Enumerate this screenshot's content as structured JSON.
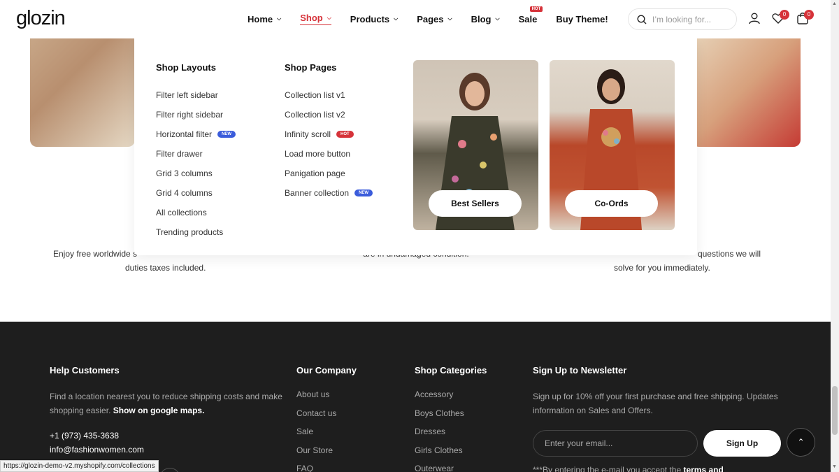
{
  "header": {
    "logo": "glozin",
    "nav": [
      {
        "label": "Home",
        "chevron": true
      },
      {
        "label": "Shop",
        "chevron": true,
        "active": true
      },
      {
        "label": "Products",
        "chevron": true
      },
      {
        "label": "Pages",
        "chevron": true
      },
      {
        "label": "Blog",
        "chevron": true
      },
      {
        "label": "Sale",
        "badge": "HOT"
      },
      {
        "label": "Buy Theme!"
      }
    ],
    "search_placeholder": "I’m looking for...",
    "wishlist_count": "0",
    "cart_count": "0"
  },
  "mega_menu": {
    "col1": {
      "title": "Shop Layouts",
      "items": [
        {
          "label": "Filter left sidebar"
        },
        {
          "label": "Filter right sidebar"
        },
        {
          "label": "Horizontal filter",
          "badge": "NEW"
        },
        {
          "label": "Filter drawer"
        },
        {
          "label": "Grid 3 columns"
        },
        {
          "label": "Grid 4 columns"
        },
        {
          "label": "All collections"
        },
        {
          "label": "Trending products"
        }
      ]
    },
    "col2": {
      "title": "Shop Pages",
      "items": [
        {
          "label": "Collection list v1"
        },
        {
          "label": "Collection list v2"
        },
        {
          "label": "Infinity scroll",
          "badge": "HOT"
        },
        {
          "label": "Load more button"
        },
        {
          "label": "Panigation page"
        },
        {
          "label": "Banner collection",
          "badge": "NEW"
        }
      ]
    },
    "promos": [
      {
        "button": "Best Sellers"
      },
      {
        "button": "Co-Ords"
      }
    ]
  },
  "features": {
    "left": [
      "Enjoy free worldwide s",
      "duties taxes included."
    ],
    "middle": [
      "are in undamaged condition."
    ],
    "right": [
      "questions we will",
      "solve for you immediately."
    ]
  },
  "footer": {
    "help": {
      "title": "Help Customers",
      "text": "Find a location nearest you to reduce shipping costs and make shopping easier.",
      "map_link": "Show on google maps.",
      "phone": "+1 (973) 435-3638",
      "email": "info@fashionwomen.com"
    },
    "company": {
      "title": "Our Company",
      "links": [
        "About us",
        "Contact us",
        "Sale",
        "Our Store",
        "FAQ"
      ]
    },
    "categories": {
      "title": "Shop Categories",
      "links": [
        "Accessory",
        "Boys Clothes",
        "Dresses",
        "Girls Clothes",
        "Outerwear"
      ]
    },
    "newsletter": {
      "title": "Sign Up to Newsletter",
      "text": "Sign up for 10% off your first purchase and free shipping. Updates information on Sales and Offers.",
      "email_placeholder": "Enter your email...",
      "button": "Sign Up",
      "terms_prefix": "***By entering the e-mail you accept the",
      "terms_link": "terms and"
    }
  },
  "status_url": "https://glozin-demo-v2.myshopify.com/collections",
  "colors": {
    "accent": "#d6333a",
    "new_badge": "#3b5cdb",
    "footer_bg": "#1e1e1e"
  }
}
